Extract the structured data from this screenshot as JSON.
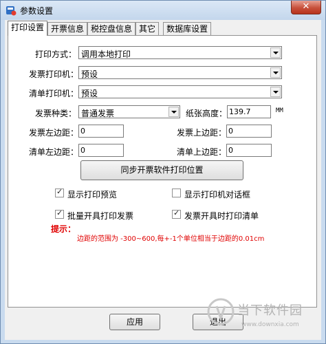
{
  "window": {
    "title": "参数设置",
    "close_label": "✕"
  },
  "tabs": [
    {
      "label": "打印设置",
      "active": true
    },
    {
      "label": "开票信息",
      "active": false
    },
    {
      "label": "税控盘信息",
      "active": false
    },
    {
      "label": "其它",
      "active": false
    },
    {
      "label": "数据库设置",
      "active": false
    }
  ],
  "print": {
    "print_method_label": "打印方式：",
    "print_method_value": "调用本地打印",
    "invoice_printer_label": "发票打印机：",
    "invoice_printer_value": "预设",
    "list_printer_label": "清单打印机：",
    "list_printer_value": "预设",
    "invoice_type_label": "发票种类：",
    "invoice_type_value": "普通发票",
    "paper_height_label": "纸张高度：",
    "paper_height_value": "139.7",
    "paper_unit": "MM",
    "invoice_left_label": "发票左边距：",
    "invoice_left_value": "0",
    "invoice_top_label": "发票上边距：",
    "invoice_top_value": "0",
    "list_left_label": "清单左边距：",
    "list_left_value": "0",
    "list_top_label": "清单上边距：",
    "list_top_value": "0",
    "sync_button_label": "同步开票软件打印位置"
  },
  "options": {
    "show_preview": {
      "label": "显示打印预览",
      "checked": true
    },
    "show_printer_dialog": {
      "label": "显示打印机对话框",
      "checked": false
    },
    "batch_print": {
      "label": "批量开具打印发票",
      "checked": true
    },
    "print_list_on_issue": {
      "label": "发票开具时打印清单",
      "checked": true
    }
  },
  "hint": {
    "label": "提示：",
    "text": "边距的范围为 -300~600,每+-1个单位相当于边距的0.01cm"
  },
  "footer": {
    "apply_label": "应用",
    "exit_label": "退出"
  },
  "watermark": {
    "brand": "当下软件园",
    "url": "www.downxia.com"
  },
  "colors": {
    "hint": "#e00000",
    "close": "#c7503b"
  }
}
